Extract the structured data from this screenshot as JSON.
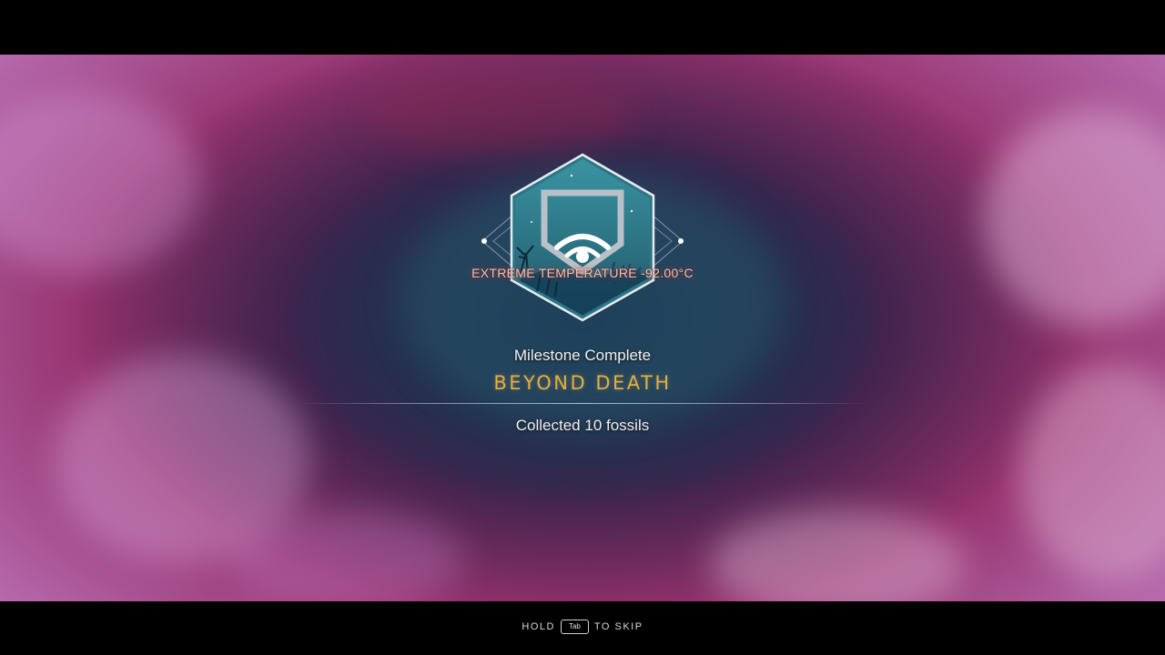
{
  "hud": {
    "temperature_warning": "EXTREME TEMPERATURE -92.00°C"
  },
  "milestone": {
    "label": "Milestone Complete",
    "title": "BEYOND DEATH",
    "description": "Collected 10 fossils",
    "badge_icon": "shield-signal-badge-icon"
  },
  "skip_prompt": {
    "hold": "HOLD",
    "key": "Tab",
    "to_skip": "TO SKIP"
  },
  "colors": {
    "title_gold": "#e0b044",
    "badge_teal": "#2e7f8e",
    "warning_pink": "#f3c3bb",
    "nebula_magenta": "#9a3070"
  }
}
